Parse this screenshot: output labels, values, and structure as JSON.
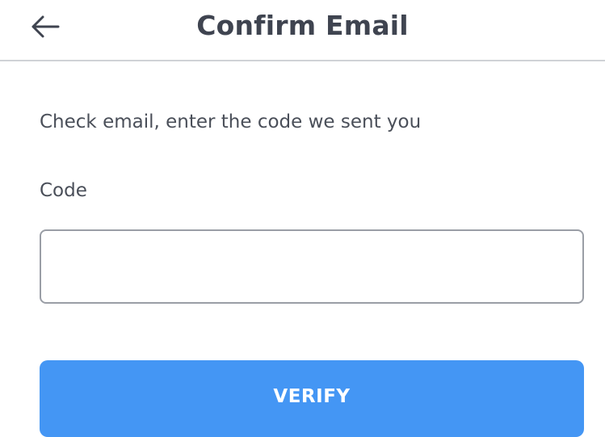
{
  "header": {
    "title": "Confirm Email",
    "back_icon": "arrow-left-icon"
  },
  "main": {
    "instruction": "Check email, enter the code we sent you",
    "code_label": "Code",
    "code_value": "",
    "code_placeholder": "",
    "verify_label": "VERIFY"
  },
  "colors": {
    "accent": "#4496f4",
    "text": "#3f4450",
    "divider": "#cfd2d6",
    "input_border": "#9a9ea6"
  }
}
